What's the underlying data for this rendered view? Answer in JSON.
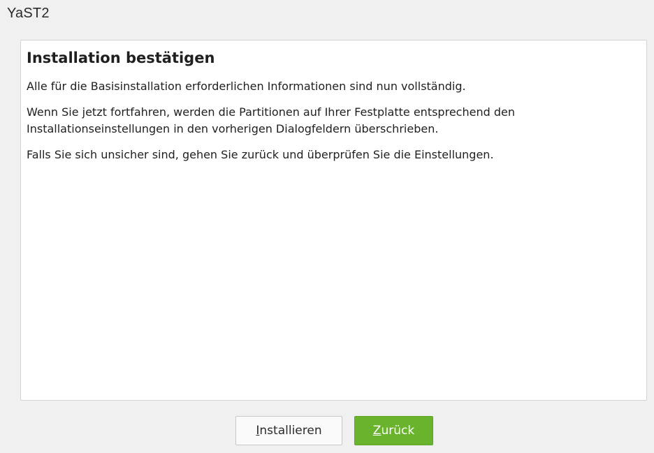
{
  "window": {
    "title": "YaST2"
  },
  "dialog": {
    "heading": "Installation bestätigen",
    "paragraphs": [
      "Alle für die Basisinstallation erforderlichen Informationen sind nun vollständig.",
      "Wenn Sie jetzt fortfahren, werden die Partitionen auf Ihrer Festplatte entsprechend den Installationseinstellungen in den vorherigen Dialogfeldern überschrieben.",
      "Falls Sie sich unsicher sind, gehen Sie zurück und überprüfen Sie die Einstellungen."
    ]
  },
  "buttons": {
    "install": {
      "mnemonic": "I",
      "rest": "nstallieren"
    },
    "back": {
      "mnemonic": "Z",
      "rest": "urück"
    }
  },
  "colors": {
    "accent_green": "#6ab42d",
    "window_background": "#f0f0f0",
    "dialog_background": "#ffffff"
  }
}
